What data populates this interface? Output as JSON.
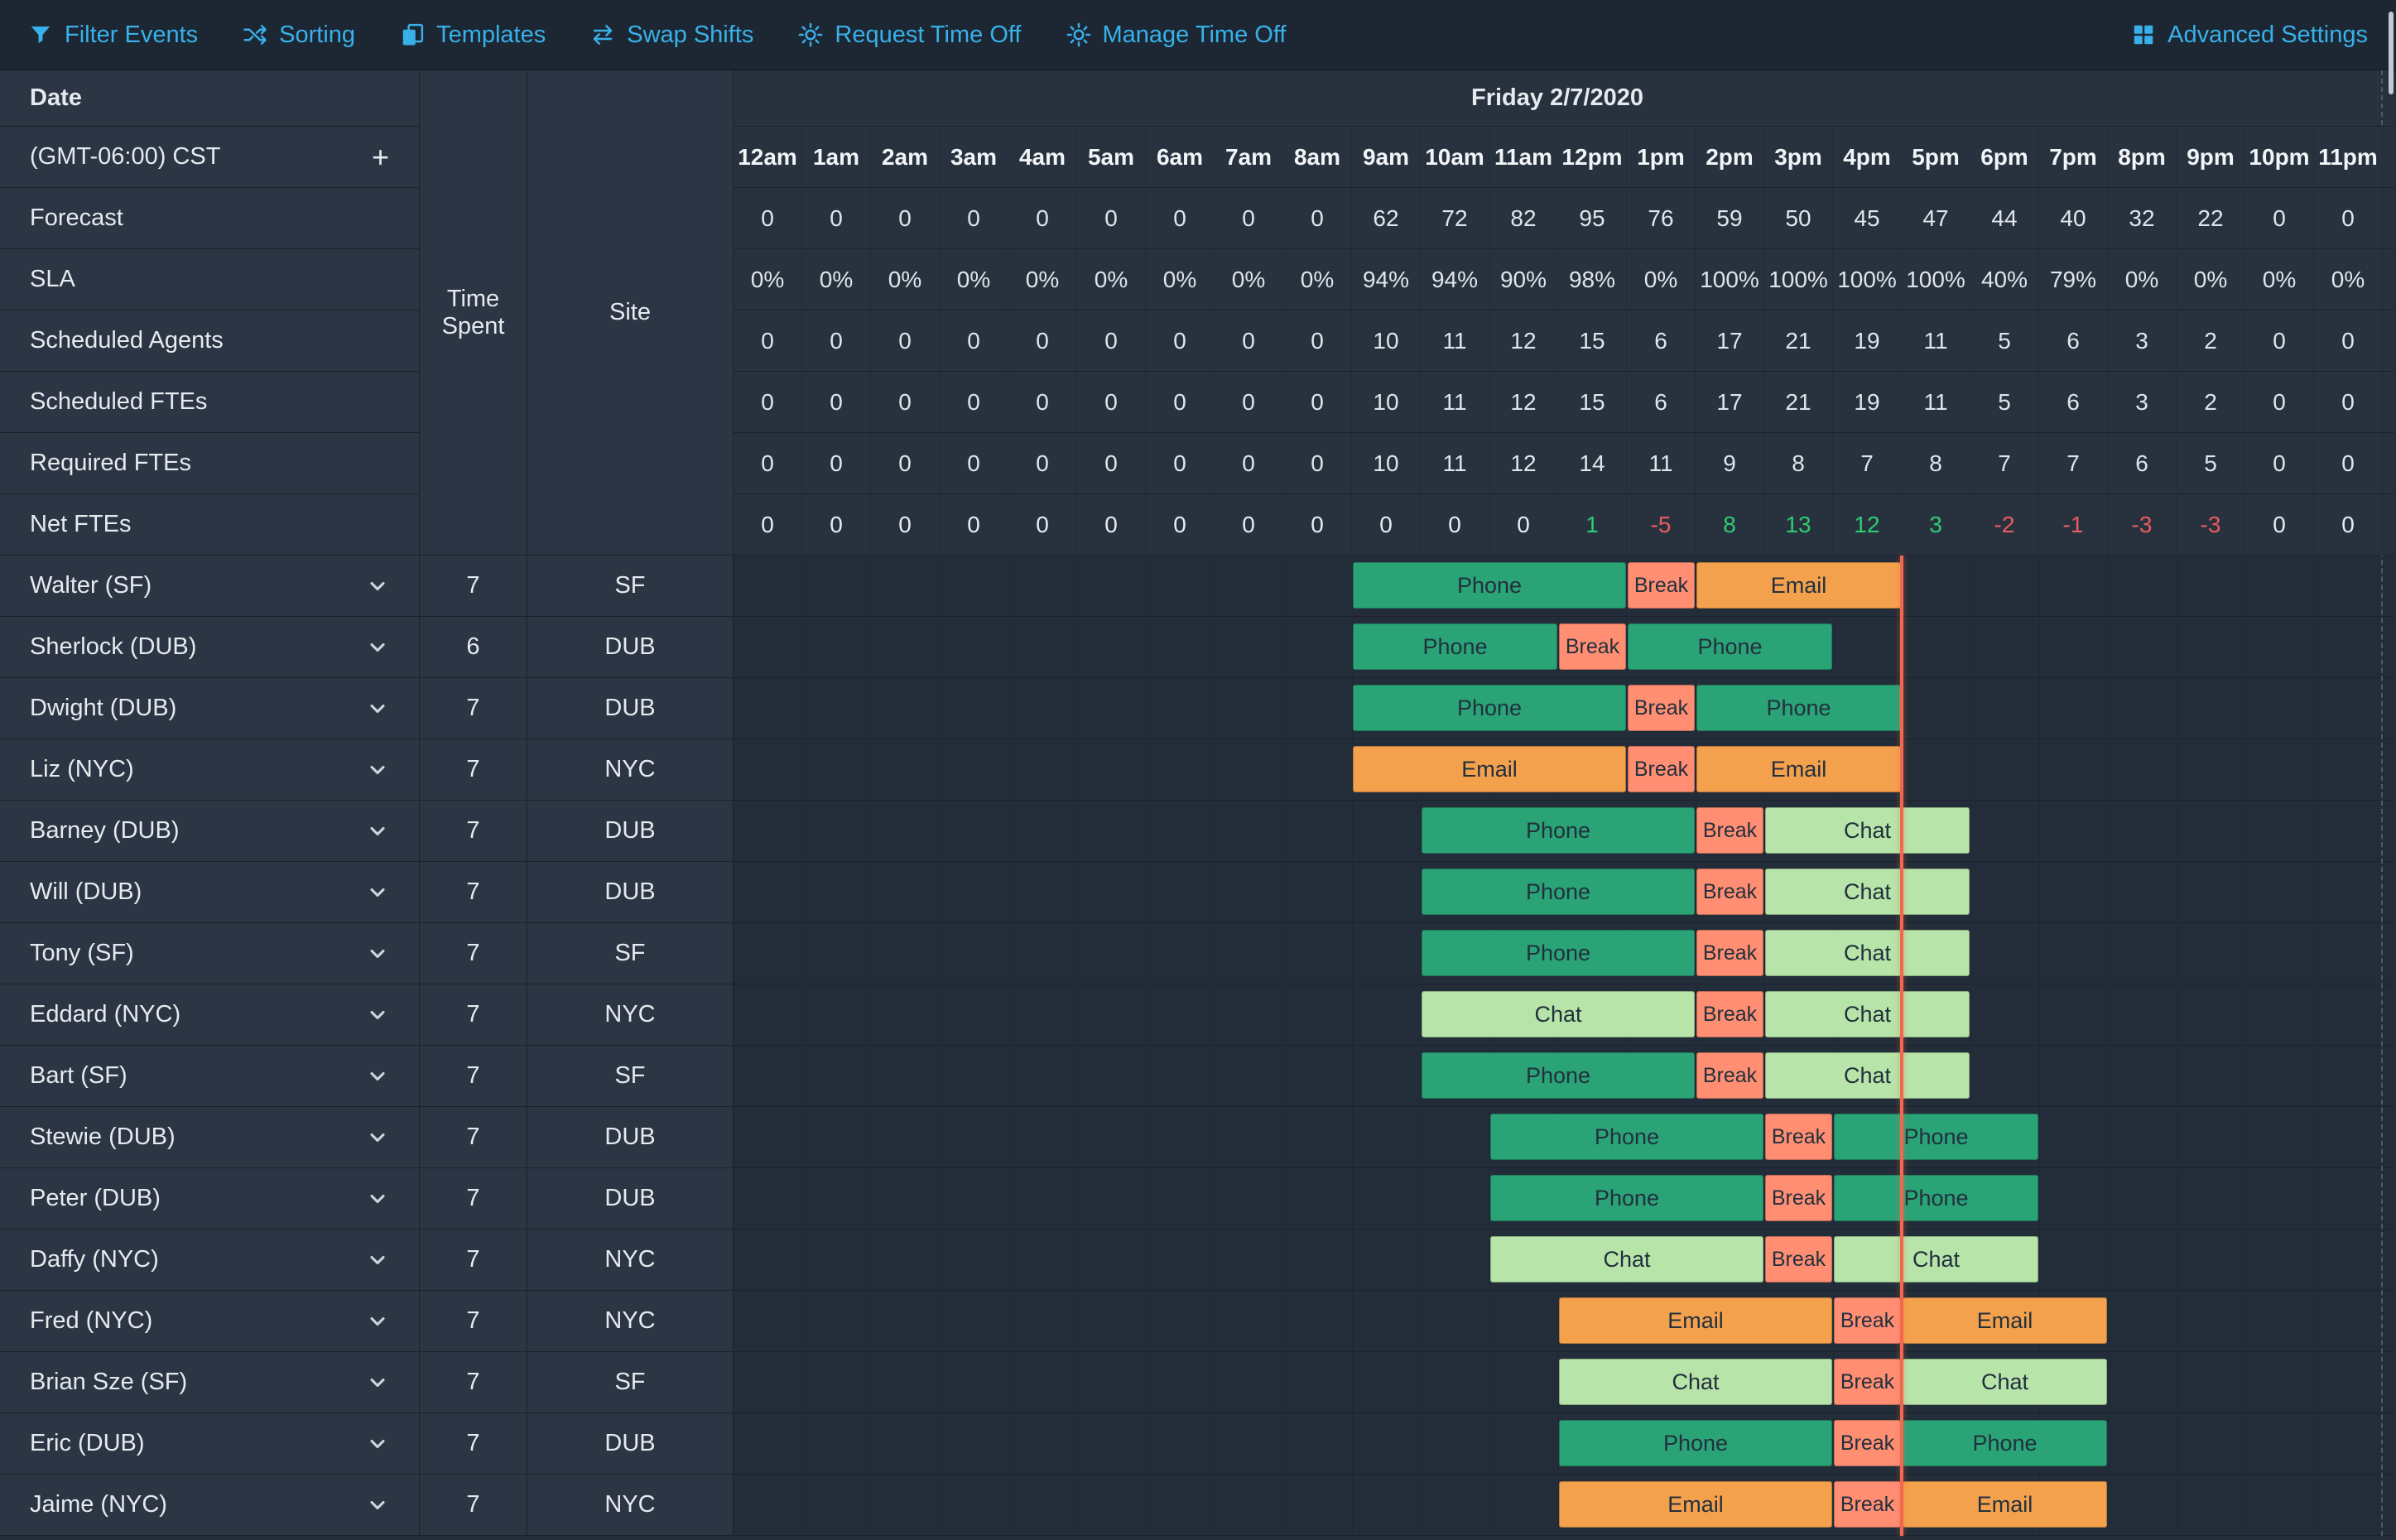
{
  "toolbar": {
    "accent_color": "#38b1ea",
    "left_items": [
      {
        "id": "filter-events",
        "label": "Filter Events",
        "icon": "filter-icon"
      },
      {
        "id": "sorting",
        "label": "Sorting",
        "icon": "shuffle-icon"
      },
      {
        "id": "templates",
        "label": "Templates",
        "icon": "templates-icon"
      },
      {
        "id": "swap-shifts",
        "label": "Swap Shifts",
        "icon": "swap-icon"
      },
      {
        "id": "request-time-off",
        "label": "Request Time Off",
        "icon": "sun-icon"
      },
      {
        "id": "manage-time-off",
        "label": "Manage Time Off",
        "icon": "sun-icon"
      }
    ],
    "right_items": [
      {
        "id": "advanced-settings",
        "label": "Advanced Settings",
        "icon": "grid-icon"
      }
    ]
  },
  "grid_header": {
    "date_label": "Date",
    "timezone_label": "(GMT-06:00) CST",
    "add_timezone_button": "+",
    "time_spent_label": "Time Spent",
    "site_label": "Site",
    "day_title": "Friday 2/7/2020",
    "hour_labels": [
      "12am",
      "1am",
      "2am",
      "3am",
      "4am",
      "5am",
      "6am",
      "7am",
      "8am",
      "9am",
      "10am",
      "11am",
      "12pm",
      "1pm",
      "2pm",
      "3pm",
      "4pm",
      "5pm",
      "6pm",
      "7pm",
      "8pm",
      "9pm",
      "10pm",
      "11pm"
    ]
  },
  "summary_rows": [
    {
      "label": "Forecast",
      "values": [
        "0",
        "0",
        "0",
        "0",
        "0",
        "0",
        "0",
        "0",
        "0",
        "62",
        "72",
        "82",
        "95",
        "76",
        "59",
        "50",
        "45",
        "47",
        "44",
        "40",
        "32",
        "22",
        "0",
        "0"
      ]
    },
    {
      "label": "SLA",
      "values": [
        "0%",
        "0%",
        "0%",
        "0%",
        "0%",
        "0%",
        "0%",
        "0%",
        "0%",
        "94%",
        "94%",
        "90%",
        "98%",
        "0%",
        "100%",
        "100%",
        "100%",
        "100%",
        "40%",
        "79%",
        "0%",
        "0%",
        "0%",
        "0%"
      ]
    },
    {
      "label": "Scheduled Agents",
      "values": [
        "0",
        "0",
        "0",
        "0",
        "0",
        "0",
        "0",
        "0",
        "0",
        "10",
        "11",
        "12",
        "15",
        "6",
        "17",
        "21",
        "19",
        "11",
        "5",
        "6",
        "3",
        "2",
        "0",
        "0"
      ]
    },
    {
      "label": "Scheduled FTEs",
      "values": [
        "0",
        "0",
        "0",
        "0",
        "0",
        "0",
        "0",
        "0",
        "0",
        "10",
        "11",
        "12",
        "15",
        "6",
        "17",
        "21",
        "19",
        "11",
        "5",
        "6",
        "3",
        "2",
        "0",
        "0"
      ]
    },
    {
      "label": "Required FTEs",
      "values": [
        "0",
        "0",
        "0",
        "0",
        "0",
        "0",
        "0",
        "0",
        "0",
        "10",
        "11",
        "12",
        "14",
        "11",
        "9",
        "8",
        "7",
        "8",
        "7",
        "7",
        "6",
        "5",
        "0",
        "0"
      ]
    },
    {
      "label": "Net FTEs",
      "colorize": true,
      "values": [
        "0",
        "0",
        "0",
        "0",
        "0",
        "0",
        "0",
        "0",
        "0",
        "0",
        "0",
        "0",
        "1",
        "-5",
        "8",
        "13",
        "12",
        "3",
        "-2",
        "-1",
        "-3",
        "-3",
        "0",
        "0"
      ]
    }
  ],
  "schedule": {
    "current_time_hour": 17,
    "shift_colors": {
      "Phone": "#2aa377",
      "Email": "#f4a14e",
      "Chat": "#b7e4a9",
      "Break": "#ff8e73"
    },
    "net_fte_colors": {
      "positive": "#2ecc71",
      "negative": "#e85c5c",
      "neutral": "#e8ecf1"
    },
    "timeline_color": "#f0694f"
  },
  "agents": [
    {
      "name": "Walter (SF)",
      "time_spent": "7",
      "site": "SF",
      "shifts": [
        {
          "label": "Phone",
          "start": 9,
          "end": 13
        },
        {
          "label": "Break",
          "start": 13,
          "end": 14
        },
        {
          "label": "Email",
          "start": 14,
          "end": 17
        }
      ]
    },
    {
      "name": "Sherlock (DUB)",
      "time_spent": "6",
      "site": "DUB",
      "shifts": [
        {
          "label": "Phone",
          "start": 9,
          "end": 12
        },
        {
          "label": "Break",
          "start": 12,
          "end": 13
        },
        {
          "label": "Phone",
          "start": 13,
          "end": 16
        }
      ]
    },
    {
      "name": "Dwight (DUB)",
      "time_spent": "7",
      "site": "DUB",
      "shifts": [
        {
          "label": "Phone",
          "start": 9,
          "end": 13
        },
        {
          "label": "Break",
          "start": 13,
          "end": 14
        },
        {
          "label": "Phone",
          "start": 14,
          "end": 17
        }
      ]
    },
    {
      "name": "Liz (NYC)",
      "time_spent": "7",
      "site": "NYC",
      "shifts": [
        {
          "label": "Email",
          "start": 9,
          "end": 13
        },
        {
          "label": "Break",
          "start": 13,
          "end": 14
        },
        {
          "label": "Email",
          "start": 14,
          "end": 17
        }
      ]
    },
    {
      "name": "Barney (DUB)",
      "time_spent": "7",
      "site": "DUB",
      "shifts": [
        {
          "label": "Phone",
          "start": 10,
          "end": 14
        },
        {
          "label": "Break",
          "start": 14,
          "end": 15
        },
        {
          "label": "Chat",
          "start": 15,
          "end": 18
        }
      ]
    },
    {
      "name": "Will (DUB)",
      "time_spent": "7",
      "site": "DUB",
      "shifts": [
        {
          "label": "Phone",
          "start": 10,
          "end": 14
        },
        {
          "label": "Break",
          "start": 14,
          "end": 15
        },
        {
          "label": "Chat",
          "start": 15,
          "end": 18
        }
      ]
    },
    {
      "name": "Tony (SF)",
      "time_spent": "7",
      "site": "SF",
      "shifts": [
        {
          "label": "Phone",
          "start": 10,
          "end": 14
        },
        {
          "label": "Break",
          "start": 14,
          "end": 15
        },
        {
          "label": "Chat",
          "start": 15,
          "end": 18
        }
      ]
    },
    {
      "name": "Eddard (NYC)",
      "time_spent": "7",
      "site": "NYC",
      "shifts": [
        {
          "label": "Chat",
          "start": 10,
          "end": 14
        },
        {
          "label": "Break",
          "start": 14,
          "end": 15
        },
        {
          "label": "Chat",
          "start": 15,
          "end": 18
        }
      ]
    },
    {
      "name": "Bart (SF)",
      "time_spent": "7",
      "site": "SF",
      "shifts": [
        {
          "label": "Phone",
          "start": 10,
          "end": 14
        },
        {
          "label": "Break",
          "start": 14,
          "end": 15
        },
        {
          "label": "Chat",
          "start": 15,
          "end": 18
        }
      ]
    },
    {
      "name": "Stewie (DUB)",
      "time_spent": "7",
      "site": "DUB",
      "shifts": [
        {
          "label": "Phone",
          "start": 11,
          "end": 15
        },
        {
          "label": "Break",
          "start": 15,
          "end": 16
        },
        {
          "label": "Phone",
          "start": 16,
          "end": 19
        }
      ]
    },
    {
      "name": "Peter (DUB)",
      "time_spent": "7",
      "site": "DUB",
      "shifts": [
        {
          "label": "Phone",
          "start": 11,
          "end": 15
        },
        {
          "label": "Break",
          "start": 15,
          "end": 16
        },
        {
          "label": "Phone",
          "start": 16,
          "end": 19
        }
      ]
    },
    {
      "name": "Daffy (NYC)",
      "time_spent": "7",
      "site": "NYC",
      "shifts": [
        {
          "label": "Chat",
          "start": 11,
          "end": 15
        },
        {
          "label": "Break",
          "start": 15,
          "end": 16
        },
        {
          "label": "Chat",
          "start": 16,
          "end": 19
        }
      ]
    },
    {
      "name": "Fred (NYC)",
      "time_spent": "7",
      "site": "NYC",
      "shifts": [
        {
          "label": "Email",
          "start": 12,
          "end": 16
        },
        {
          "label": "Break",
          "start": 16,
          "end": 17
        },
        {
          "label": "Email",
          "start": 17,
          "end": 20
        }
      ]
    },
    {
      "name": "Brian Sze (SF)",
      "time_spent": "7",
      "site": "SF",
      "shifts": [
        {
          "label": "Chat",
          "start": 12,
          "end": 16
        },
        {
          "label": "Break",
          "start": 16,
          "end": 17
        },
        {
          "label": "Chat",
          "start": 17,
          "end": 20
        }
      ]
    },
    {
      "name": "Eric (DUB)",
      "time_spent": "7",
      "site": "DUB",
      "shifts": [
        {
          "label": "Phone",
          "start": 12,
          "end": 16
        },
        {
          "label": "Break",
          "start": 16,
          "end": 17
        },
        {
          "label": "Phone",
          "start": 17,
          "end": 20
        }
      ]
    },
    {
      "name": "Jaime (NYC)",
      "time_spent": "7",
      "site": "NYC",
      "shifts": [
        {
          "label": "Email",
          "start": 12,
          "end": 16
        },
        {
          "label": "Break",
          "start": 16,
          "end": 17
        },
        {
          "label": "Email",
          "start": 17,
          "end": 20
        }
      ]
    }
  ]
}
